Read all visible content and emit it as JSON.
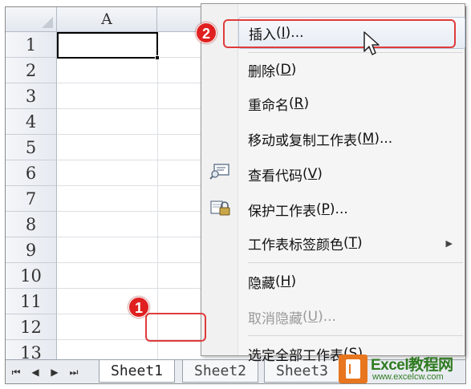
{
  "spreadsheet": {
    "columns": [
      "A"
    ],
    "rows": [
      "1",
      "2",
      "3",
      "4",
      "5",
      "6",
      "7",
      "8",
      "9",
      "10",
      "11",
      "12",
      "13"
    ]
  },
  "tabs": {
    "nav": [
      "⏮",
      "◀",
      "▶",
      "⏭"
    ],
    "sheets": [
      "Sheet1",
      "Sheet2",
      "Sheet3"
    ]
  },
  "context_menu": {
    "items": [
      {
        "label": "插入",
        "accel": "I",
        "suffix": "...",
        "state": "hover"
      },
      {
        "label": "删除",
        "accel": "D",
        "suffix": ""
      },
      {
        "label": "重命名",
        "accel": "R",
        "suffix": ""
      },
      {
        "label": "移动或复制工作表",
        "accel": "M",
        "suffix": "..."
      },
      {
        "label": "查看代码",
        "accel": "V",
        "suffix": "",
        "icon": "view-code-icon"
      },
      {
        "label": "保护工作表",
        "accel": "P",
        "suffix": "...",
        "icon": "protect-sheet-icon"
      },
      {
        "label": "工作表标签颜色",
        "accel": "T",
        "suffix": "",
        "submenu": true
      },
      {
        "label": "隐藏",
        "accel": "H",
        "suffix": ""
      },
      {
        "label": "取消隐藏",
        "accel": "U",
        "suffix": "...",
        "state": "disabled"
      },
      {
        "label": "选定全部工作表",
        "accel": "S",
        "suffix": ""
      }
    ]
  },
  "annotations": {
    "step1": "1",
    "step2": "2"
  },
  "watermark": {
    "brand": "Excel教程网",
    "site": "www.excelcw.com"
  },
  "colors": {
    "annotation": "#e03b3b",
    "badge": "#e02020",
    "watermark_green": "#2f7b21",
    "watermark_orange": "#e7761f"
  }
}
